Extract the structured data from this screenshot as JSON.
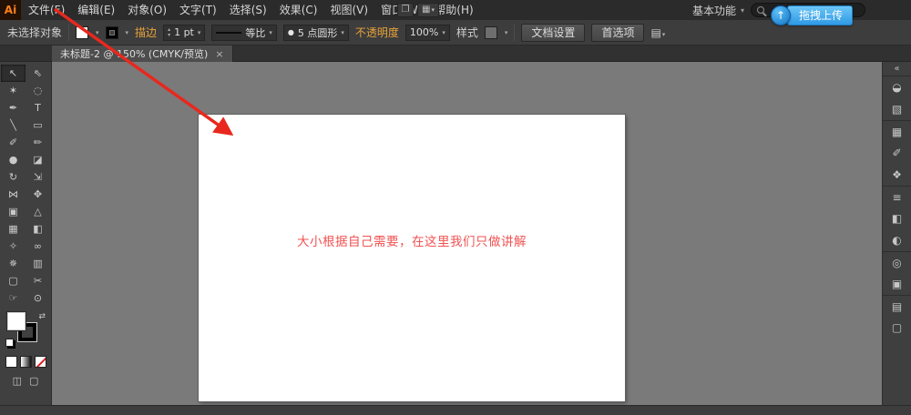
{
  "colors": {
    "accent_orange": "#e8a33b",
    "annotation_red": "#e8281e",
    "artboard_text_red": "#f25252",
    "badge_blue": "#2f9ae6"
  },
  "ui": {
    "caret": "▾",
    "stepper_up": "▴",
    "stepper_down": "▾",
    "swap_glyph": "⇄"
  },
  "menubar": {
    "logo": "Ai",
    "items": [
      "文件(F)",
      "编辑(E)",
      "对象(O)",
      "文字(T)",
      "选择(S)",
      "效果(C)",
      "视图(V)",
      "窗口(W)",
      "帮助(H)"
    ],
    "arrange_icon_glyph": "❐",
    "layout_icon_glyph": "▦",
    "workspace_label": "基本功能",
    "upload_icon_glyph": "↑",
    "upload_badge_label": "拖拽上传"
  },
  "controlbar": {
    "selection_status": "未选择对象",
    "stroke_label": "描边",
    "stroke_width_value": "1 pt",
    "profile_value": "等比",
    "brush_dot": "●",
    "brush_value": "5 点圆形",
    "opacity_label": "不透明度",
    "opacity_value": "100%",
    "style_label": "样式",
    "doc_setup_label": "文档设置",
    "preferences_label": "首选项",
    "panel_menu_glyph": "▤"
  },
  "tabbar": {
    "title": "未标题-2 @ 150% (CMYK/预览)",
    "close_glyph": "×"
  },
  "tools": [
    {
      "name": "selection-tool",
      "glyph": "↖",
      "active": true
    },
    {
      "name": "direct-selection-tool",
      "glyph": "⇖"
    },
    {
      "name": "magic-wand-tool",
      "glyph": "✶"
    },
    {
      "name": "lasso-tool",
      "glyph": "◌"
    },
    {
      "name": "pen-tool",
      "glyph": "✒"
    },
    {
      "name": "type-tool",
      "glyph": "T"
    },
    {
      "name": "line-segment-tool",
      "glyph": "╲"
    },
    {
      "name": "rectangle-tool",
      "glyph": "▭"
    },
    {
      "name": "paintbrush-tool",
      "glyph": "✐"
    },
    {
      "name": "pencil-tool",
      "glyph": "✏"
    },
    {
      "name": "blob-brush-tool",
      "glyph": "●"
    },
    {
      "name": "eraser-tool",
      "glyph": "◪"
    },
    {
      "name": "rotate-tool",
      "glyph": "↻"
    },
    {
      "name": "scale-tool",
      "glyph": "⇲"
    },
    {
      "name": "width-tool",
      "glyph": "⋈"
    },
    {
      "name": "free-transform-tool",
      "glyph": "✥"
    },
    {
      "name": "shape-builder-tool",
      "glyph": "▣"
    },
    {
      "name": "perspective-grid-tool",
      "glyph": "△"
    },
    {
      "name": "mesh-tool",
      "glyph": "▦"
    },
    {
      "name": "gradient-tool",
      "glyph": "◧"
    },
    {
      "name": "eyedropper-tool",
      "glyph": "✧"
    },
    {
      "name": "blend-tool",
      "glyph": "∞"
    },
    {
      "name": "symbol-sprayer-tool",
      "glyph": "✵"
    },
    {
      "name": "column-graph-tool",
      "glyph": "▥"
    },
    {
      "name": "artboard-tool",
      "glyph": "▢"
    },
    {
      "name": "slice-tool",
      "glyph": "✂"
    },
    {
      "name": "hand-tool",
      "glyph": "☞"
    },
    {
      "name": "zoom-tool",
      "glyph": "⊙"
    }
  ],
  "rightdock": {
    "expand_glyph": "«",
    "icons": [
      {
        "name": "color-panel-icon",
        "glyph": "◒"
      },
      {
        "name": "color-guide-panel-icon",
        "glyph": "▧"
      },
      {
        "name": "swatches-panel-icon",
        "glyph": "▦",
        "divider": true
      },
      {
        "name": "brushes-panel-icon",
        "glyph": "✐"
      },
      {
        "name": "symbols-panel-icon",
        "glyph": "❖"
      },
      {
        "name": "stroke-panel-icon",
        "glyph": "≡",
        "divider": true
      },
      {
        "name": "gradient-panel-icon",
        "glyph": "◧"
      },
      {
        "name": "transparency-panel-icon",
        "glyph": "◐"
      },
      {
        "name": "appearance-panel-icon",
        "glyph": "◎",
        "divider": true
      },
      {
        "name": "graphic-styles-panel-icon",
        "glyph": "▣"
      },
      {
        "name": "layers-panel-icon",
        "glyph": "▤",
        "divider": true
      },
      {
        "name": "artboards-panel-icon",
        "glyph": "▢"
      }
    ]
  },
  "canvas": {
    "artboard_text": "大小根据自己需要，在这里我们只做讲解"
  }
}
